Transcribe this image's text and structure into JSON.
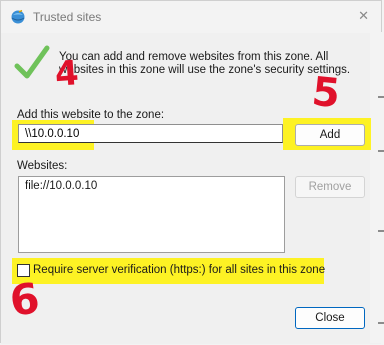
{
  "window": {
    "title": "Trusted sites",
    "close_glyph": "✕"
  },
  "intro": {
    "icon": "green-check-icon",
    "text": "You can add and remove websites from this zone. All websites in this zone will use the zone's security settings."
  },
  "add_section": {
    "label": "Add this website to the zone:",
    "input_value": "\\\\10.0.0.10",
    "add_button": "Add"
  },
  "websites_section": {
    "label": "Websites:",
    "items": [
      "file://10.0.0.10"
    ],
    "remove_button": "Remove"
  },
  "verification": {
    "checked": false,
    "label": "Require server verification (https:) for all sites in this zone"
  },
  "footer": {
    "close_button": "Close"
  },
  "annotations": {
    "four": "4",
    "five": "5",
    "six": "6",
    "highlight_color": "#fff200",
    "ink_color": "#e0112b"
  }
}
